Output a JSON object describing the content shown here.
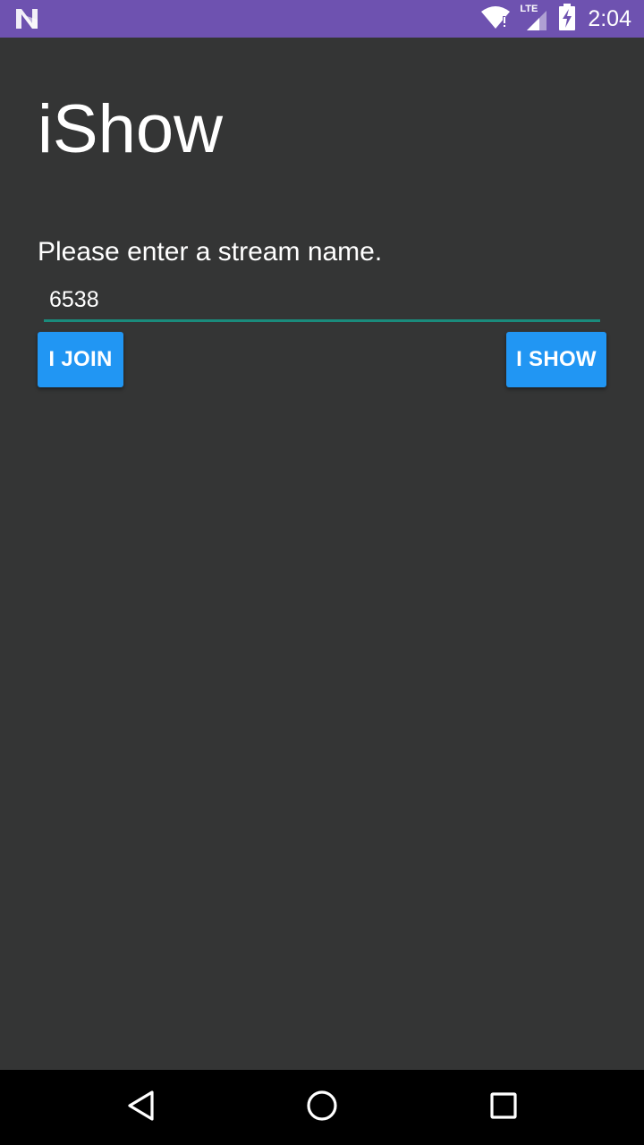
{
  "status_bar": {
    "time": "2:04",
    "network_label": "LTE",
    "icons": [
      "n-logo-icon",
      "wifi-icon",
      "lte-signal-icon",
      "battery-charging-icon"
    ],
    "background": "#6e52b0"
  },
  "app": {
    "title": "iShow",
    "prompt": "Please enter a stream name.",
    "stream_input": {
      "value": "6538",
      "placeholder": ""
    },
    "buttons": {
      "join_label": "I JOIN",
      "show_label": "I SHOW"
    },
    "colors": {
      "background": "#343535",
      "button": "#2196f3",
      "input_underline": "#1a8b7c"
    }
  },
  "nav_bar": {
    "icons": [
      "back-icon",
      "home-icon",
      "recents-icon"
    ]
  }
}
